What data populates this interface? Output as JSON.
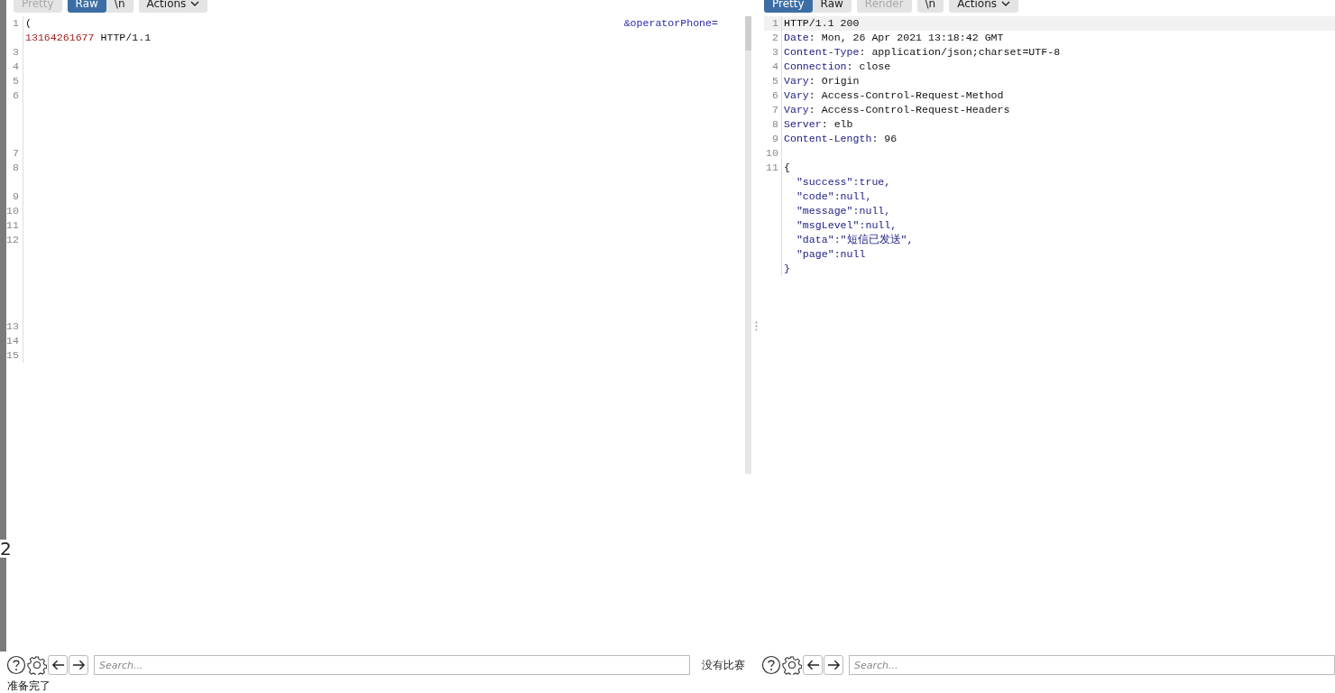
{
  "edge_mark": "2",
  "request": {
    "tabs": [
      {
        "label": "Pretty",
        "selected": false,
        "disabled": true,
        "kind": "tab"
      },
      {
        "label": "Raw",
        "selected": true,
        "disabled": false,
        "kind": "tab"
      },
      {
        "label": "\\n",
        "selected": false,
        "disabled": false,
        "kind": "tab"
      },
      {
        "label": "Actions",
        "selected": false,
        "disabled": false,
        "kind": "menu"
      }
    ],
    "lines": [
      {
        "number": "1",
        "kind": "single",
        "segments": [
          {
            "text": "(",
            "kind": "plain",
            "right_aligned": false
          },
          {
            "text": "&operatorPhone=",
            "kind": "param",
            "right_aligned": true
          }
        ],
        "wrap": [
          {
            "text": "13164261677",
            "kind": "value"
          },
          {
            "text": " HTTP/1.1",
            "kind": "plain"
          }
        ]
      },
      {
        "number": "3",
        "kind": "single"
      },
      {
        "number": "4",
        "kind": "single"
      },
      {
        "number": "5",
        "kind": "single"
      },
      {
        "number": "6",
        "kind": "quad"
      },
      {
        "number": "7",
        "kind": "single"
      },
      {
        "number": "8",
        "kind": "double"
      },
      {
        "number": "9",
        "kind": "single"
      },
      {
        "number": "10",
        "kind": "single"
      },
      {
        "number": "11",
        "kind": "single"
      },
      {
        "number": "12",
        "kind": "sextuple"
      },
      {
        "number": "13",
        "kind": "single"
      },
      {
        "number": "14",
        "kind": "single"
      },
      {
        "number": "15",
        "kind": "single"
      }
    ],
    "search": {
      "placeholder": "Search..."
    },
    "match_status": "没有比赛"
  },
  "response": {
    "tabs": [
      {
        "label": "Pretty",
        "selected": true,
        "disabled": false,
        "kind": "tab"
      },
      {
        "label": "Raw",
        "selected": false,
        "disabled": false,
        "kind": "tab"
      },
      {
        "label": "Render",
        "selected": false,
        "disabled": true,
        "kind": "tab"
      },
      {
        "label": "\\n",
        "selected": false,
        "disabled": false,
        "kind": "tab"
      },
      {
        "label": "Actions",
        "selected": false,
        "disabled": false,
        "kind": "menu"
      }
    ],
    "lines": [
      {
        "number": "1",
        "segments": [
          {
            "text": "HTTP/1.1 200",
            "kind": "plain"
          }
        ]
      },
      {
        "number": "2",
        "segments": [
          {
            "text": "Date",
            "kind": "name"
          },
          {
            "text": ": Mon, 26 Apr 2021 13:18:42 GMT",
            "kind": "plain"
          }
        ]
      },
      {
        "number": "3",
        "segments": [
          {
            "text": "Content-Type",
            "kind": "name"
          },
          {
            "text": ": application/json;charset=UTF-8",
            "kind": "plain"
          }
        ]
      },
      {
        "number": "4",
        "segments": [
          {
            "text": "Connection",
            "kind": "name"
          },
          {
            "text": ": close",
            "kind": "plain"
          }
        ]
      },
      {
        "number": "5",
        "segments": [
          {
            "text": "Vary",
            "kind": "name"
          },
          {
            "text": ": Origin",
            "kind": "plain"
          }
        ]
      },
      {
        "number": "6",
        "segments": [
          {
            "text": "Vary",
            "kind": "name"
          },
          {
            "text": ": Access-Control-Request-Method",
            "kind": "plain"
          }
        ]
      },
      {
        "number": "7",
        "segments": [
          {
            "text": "Vary",
            "kind": "name"
          },
          {
            "text": ": Access-Control-Request-Headers",
            "kind": "plain"
          }
        ]
      },
      {
        "number": "8",
        "segments": [
          {
            "text": "Server",
            "kind": "name"
          },
          {
            "text": ": elb",
            "kind": "plain"
          }
        ]
      },
      {
        "number": "9",
        "segments": [
          {
            "text": "Content-Length",
            "kind": "name"
          },
          {
            "text": ": 96",
            "kind": "plain"
          }
        ]
      },
      {
        "number": "10"
      },
      {
        "number": "11",
        "segments": [
          {
            "text": "{",
            "kind": "plain"
          }
        ],
        "body": [
          "  \"success\":true,",
          "  \"code\":null,",
          "  \"message\":null,",
          "  \"msgLevel\":null,",
          "  \"data\":\"短信已发送\",",
          "  \"page\":null",
          "}"
        ]
      }
    ],
    "search": {
      "placeholder": "Search..."
    }
  },
  "status_bar": "准备完了"
}
